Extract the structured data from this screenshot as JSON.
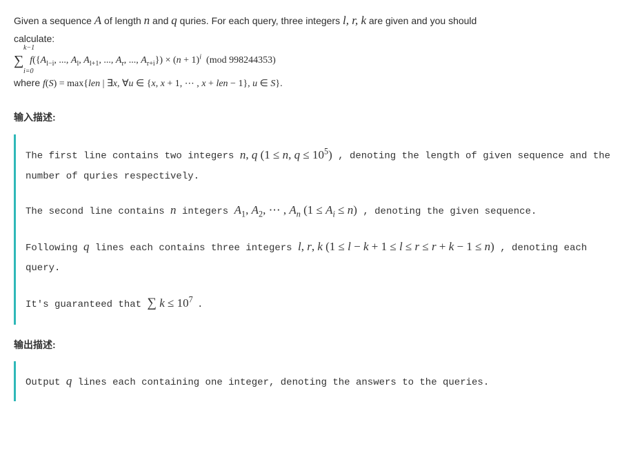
{
  "problem": {
    "line1": "Given a sequence A of length n and q quries. For each query, three integers l, r, k are given and you should",
    "line2": "calculate:",
    "formula_sum": "∑",
    "formula_upper": "k−1",
    "formula_lower": "i=0",
    "formula_body": "f({Aₗ₋ᵢ, ..., Aₗ, Aₗ₊₁, ..., Aᵣ, ..., Aᵣ₊ᵢ}) × (n + 1)ⁱ  (mod 998244353)",
    "where_prefix": "where ",
    "where_formula": "f(S) = max{len | ∃x, ∀u ∈ {x, x + 1, ⋯ , x + len − 1}, u ∈ S}.",
    "formula_sub_text_l_minus_i": "l−i",
    "formula_sub_text_l": "l",
    "formula_sub_text_l_plus_1": "l+1",
    "formula_sub_text_r": "r",
    "formula_sub_text_r_plus_i": "r+i"
  },
  "sections": {
    "input_title": "输入描述:",
    "output_title": "输出描述:"
  },
  "input": {
    "p1_prefix": "The first line contains two integers ",
    "p1_math": "n, q (1 ≤ n, q ≤ 10⁵)",
    "p1_suffix": ", denoting the length of given sequence and the number of quries respectively.",
    "p2_prefix": "The second line contains ",
    "p2_n": "n",
    "p2_mid": " integers ",
    "p2_math": "A₁, A₂, ⋯ , Aₙ (1 ≤ Aᵢ ≤ n)",
    "p2_suffix": ", denoting the given sequence.",
    "p3_prefix": "Following ",
    "p3_q": "q",
    "p3_mid": " lines each contains three integers ",
    "p3_math": "l, r, k (1 ≤ l − k + 1 ≤ l ≤ r ≤ r + k − 1 ≤ n)",
    "p3_suffix": ", denoting each query.",
    "p4_prefix": "It's guaranteed that ",
    "p4_math": "∑ k ≤ 10⁷",
    "p4_suffix": "."
  },
  "output": {
    "p1_prefix": "Output ",
    "p1_q": "q",
    "p1_suffix": " lines each containing one integer, denoting the answers to the queries."
  }
}
